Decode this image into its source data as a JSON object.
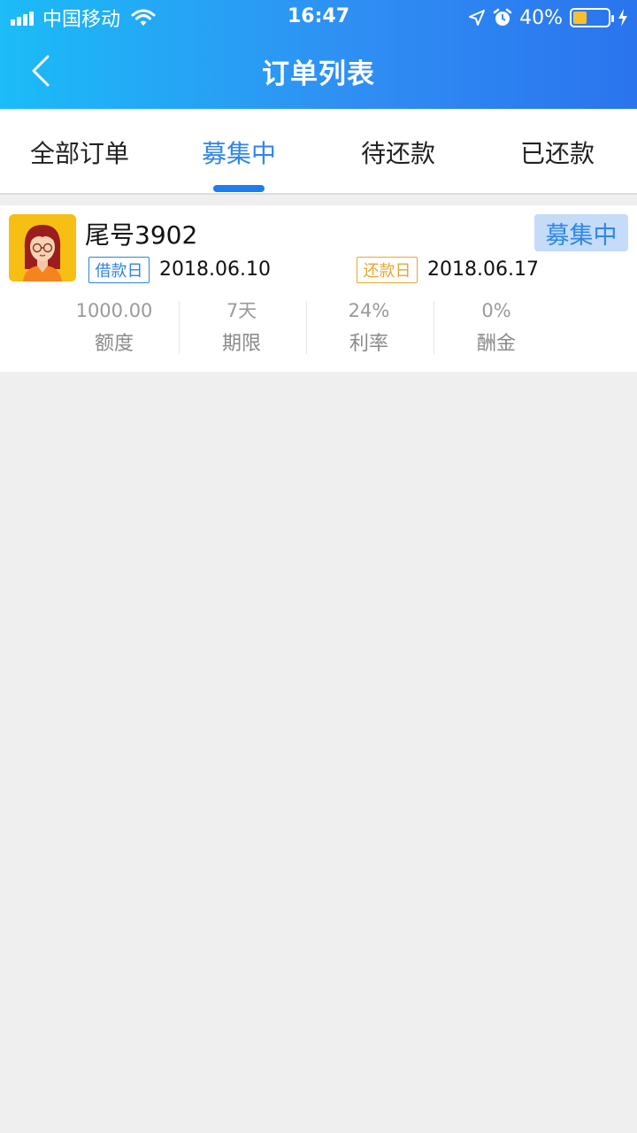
{
  "status_bar": {
    "carrier": "中国移动",
    "time": "16:47",
    "battery_percent": "40%",
    "battery_level": 0.4
  },
  "nav": {
    "title": "订单列表"
  },
  "tabs": [
    {
      "label": "全部订单",
      "active": false
    },
    {
      "label": "募集中",
      "active": true
    },
    {
      "label": "待还款",
      "active": false
    },
    {
      "label": "已还款",
      "active": false
    }
  ],
  "orders": [
    {
      "name": "尾号3902",
      "status": "募集中",
      "borrow_tag": "借款日",
      "borrow_date": "2018.06.10",
      "repay_tag": "还款日",
      "repay_date": "2018.06.17",
      "stats": [
        {
          "value": "1000.00",
          "label": "额度"
        },
        {
          "value": "7天",
          "label": "期限"
        },
        {
          "value": "24%",
          "label": "利率"
        },
        {
          "value": "0%",
          "label": "酬金"
        }
      ]
    }
  ],
  "colors": {
    "accent": "#2f87e6",
    "repay_tag": "#e6a72e",
    "avatar_bg": "#f7be13"
  }
}
